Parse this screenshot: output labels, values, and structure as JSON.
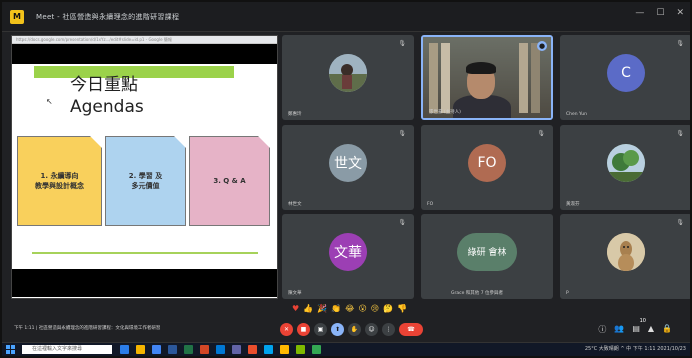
{
  "window": {
    "app_icon_label": "M",
    "title": "Meet - 社區營造與永續理念的進階研習課程",
    "controls": [
      "—",
      "☐",
      "✕"
    ]
  },
  "share": {
    "url": "https://docs.google.com/presentation/d/1xYz.../edit#slide=id.p1 - Google 簡報",
    "slide": {
      "title_line1": "今日重點",
      "title_line2": "Agendas",
      "cursor": "↖",
      "cards": [
        {
          "label": "1. 永續導向\n教學與設計概念"
        },
        {
          "label": "2. 學習 及\n多元價值"
        },
        {
          "label": "3. Q & A"
        }
      ]
    }
  },
  "participants": [
    {
      "name": "鄭惠玲",
      "avatar_type": "photo",
      "avatar_color": "#7a8f9f"
    },
    {
      "name": "張世豪 (主持人)",
      "avatar_type": "video",
      "pinned": true
    },
    {
      "name": "Chen Yun",
      "avatar_type": "letter",
      "initials": "C",
      "avatar_color": "#5b6bc7"
    },
    {
      "name": "林世文",
      "avatar_type": "letter",
      "initials": "世文",
      "avatar_color": "#8a9ba6"
    },
    {
      "name": "FO",
      "avatar_type": "letter",
      "initials": "FO",
      "avatar_color": "#b06b52"
    },
    {
      "name": "黃淑芬",
      "avatar_type": "photo",
      "avatar_color": "#5e8a5a"
    },
    {
      "name": "陳文華",
      "avatar_type": "letter",
      "initials": "文華",
      "avatar_color": "#9c3fb4"
    },
    {
      "name": "Grace 和其他 7 位參與者",
      "avatar_type": "group",
      "initials": "綠研 會林",
      "avatar_color": "#5a7f6a"
    },
    {
      "name": "P",
      "avatar_type": "photo",
      "avatar_color": "#c7a77a"
    }
  ],
  "reactions": [
    "♥",
    "👍",
    "🎉",
    "👏",
    "😂",
    "😮",
    "😢",
    "🤔",
    "👎"
  ],
  "status": {
    "text": "下午 1:11 | 社區營造與永續理念的進階研習課程：文化與環境工作者研習"
  },
  "controls": {
    "mic_icon": "mic-off-icon",
    "camera_icon": "camera-off-icon",
    "hang_up_icon": "hang-up-icon",
    "badge_count": "10"
  },
  "taskbar": {
    "search_placeholder": "在這裡輸入文字來搜尋",
    "tray_text": "25°C 大致晴朗  ^  中  下午 1:11 2021/10/23"
  },
  "colors": {
    "meet_bg": "#202124",
    "tile_bg": "#3c4043",
    "active_border": "#8ab4f8",
    "hang_up": "#ea4335",
    "slide_green": "#9bd24a",
    "card1": "#f9d05c",
    "card2": "#aed3ef",
    "card3": "#e6b3c7"
  }
}
